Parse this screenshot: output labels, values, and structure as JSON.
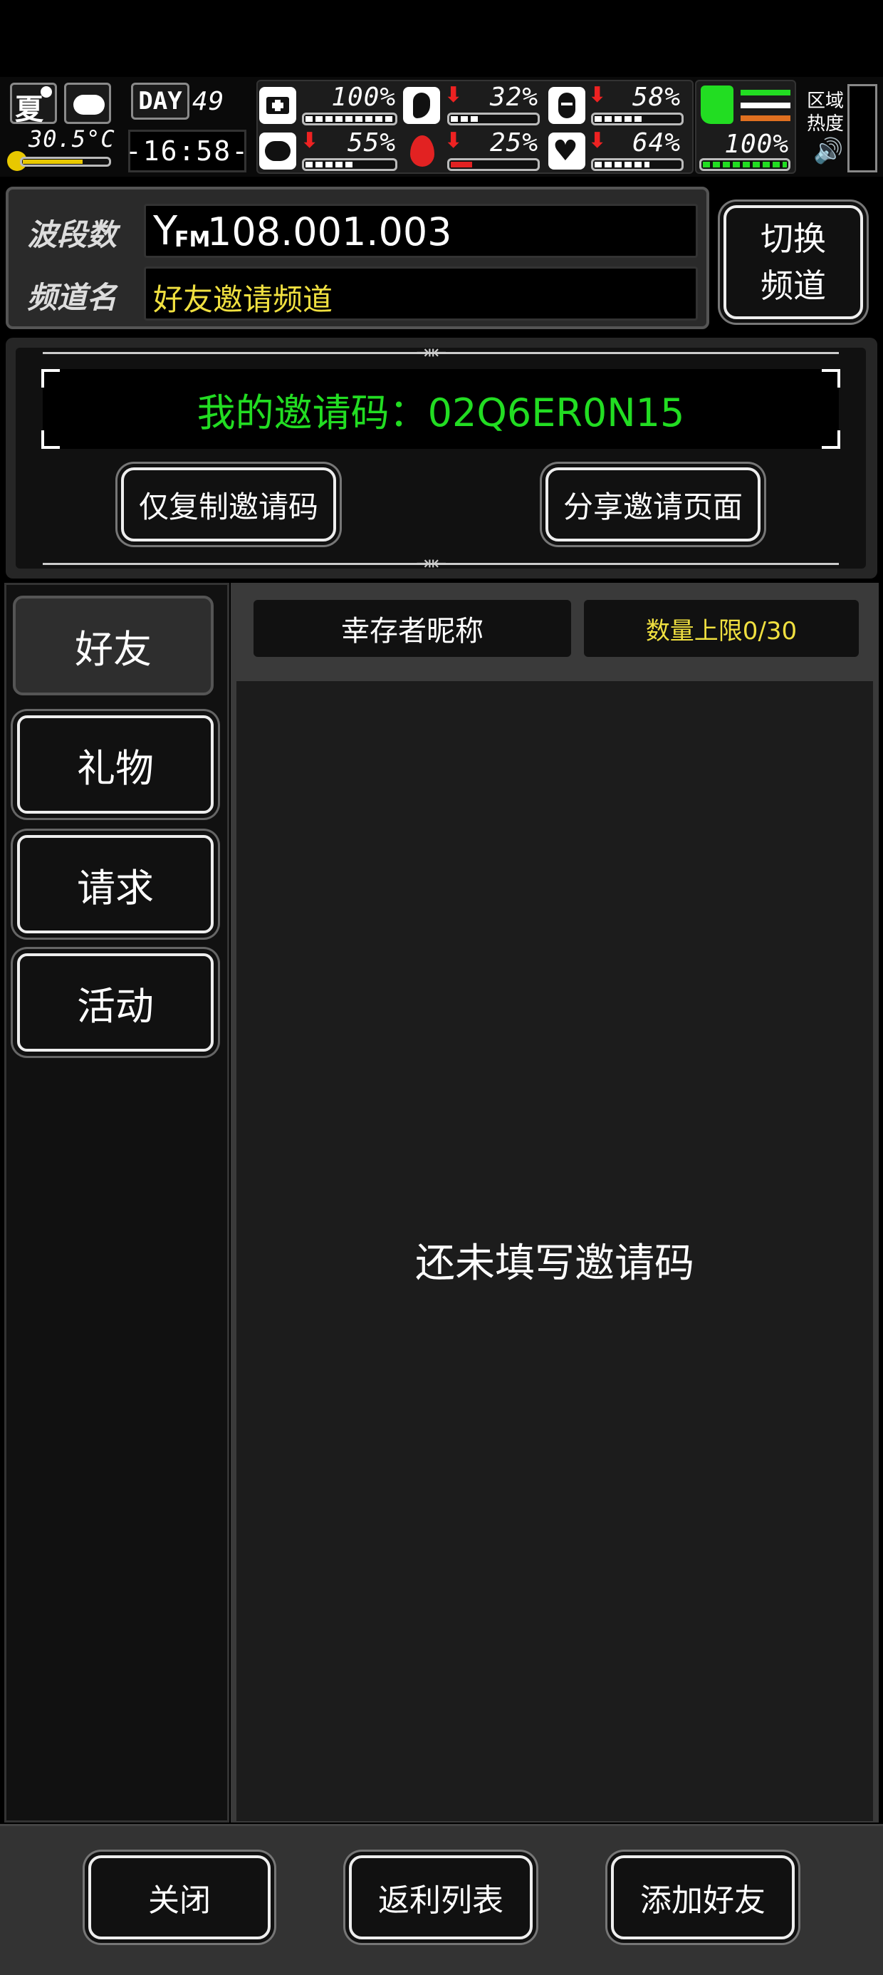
{
  "status": {
    "season": "夏",
    "temperature": "30.5°C",
    "day_label": "DAY",
    "day_number": "49",
    "time": "-16:58-",
    "stats": [
      {
        "name": "health",
        "value": "100%",
        "level": 1.0,
        "arrow": false
      },
      {
        "name": "stomach",
        "value": "32%",
        "level": 0.32,
        "arrow": true
      },
      {
        "name": "water",
        "value": "58%",
        "level": 0.58,
        "arrow": true
      },
      {
        "name": "brain",
        "value": "55%",
        "level": 0.55,
        "arrow": true
      },
      {
        "name": "blood",
        "value": "25%",
        "level": 0.25,
        "arrow": true
      },
      {
        "name": "heart",
        "value": "64%",
        "level": 0.64,
        "arrow": true
      }
    ],
    "stamina": {
      "value": "100%",
      "level": 1.0
    },
    "zone_label": "区域热度"
  },
  "channel": {
    "band_label": "波段数",
    "freq_prefix": "FM",
    "frequency": "108.001.003",
    "name_label": "频道名",
    "channel_name": "好友邀请频道",
    "switch_button": "切换频道"
  },
  "invite": {
    "code_text": "我的邀请码：02Q6ER0N15",
    "copy_button": "仅复制邀请码",
    "share_button": "分享邀请页面"
  },
  "tabs": [
    {
      "label": "好友",
      "active": true
    },
    {
      "label": "礼物",
      "active": false
    },
    {
      "label": "请求",
      "active": false
    },
    {
      "label": "活动",
      "active": false
    }
  ],
  "list": {
    "col_nickname": "幸存者昵称",
    "col_limit": "数量上限0/30",
    "empty_text": "还未填写邀请码"
  },
  "footer": {
    "close": "关闭",
    "rebate": "返利列表",
    "add_friend": "添加好友"
  },
  "colors": {
    "accent_green": "#22dd22",
    "accent_yellow": "#f0e040",
    "alert_red": "#e22222"
  }
}
